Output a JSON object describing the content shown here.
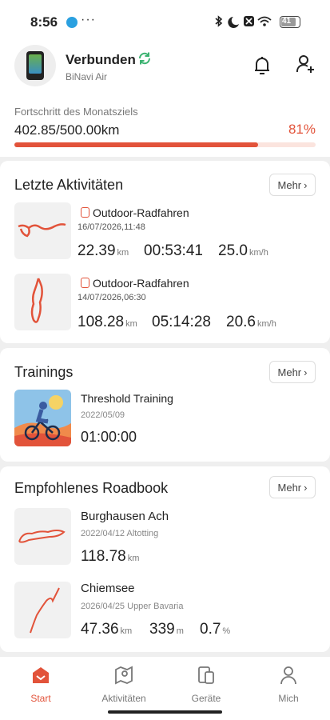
{
  "status_bar": {
    "time": "8:56",
    "more": "···",
    "battery": "41"
  },
  "header": {
    "connection_status": "Verbunden",
    "device_name": "BiNavi Air",
    "goal_label": "Fortschritt des Monatsziels",
    "goal_value": "402.85/500.00km",
    "goal_percent_text": "81%",
    "goal_progress": 0.81
  },
  "recent": {
    "title": "Letzte Aktivitäten",
    "more_label": "Mehr",
    "items": [
      {
        "type": "Outdoor-Radfahren",
        "datetime": "16/07/2026,11:48",
        "distance": "22.39",
        "distance_unit": "km",
        "duration": "00:53:41",
        "speed": "25.0",
        "speed_unit": "km/h"
      },
      {
        "type": "Outdoor-Radfahren",
        "datetime": "14/07/2026,06:30",
        "distance": "108.28",
        "distance_unit": "km",
        "duration": "05:14:28",
        "speed": "20.6",
        "speed_unit": "km/h"
      }
    ]
  },
  "trainings": {
    "title": "Trainings",
    "more_label": "Mehr",
    "item": {
      "name": "Threshold Training",
      "date": "2022/05/09",
      "duration": "01:00:00"
    }
  },
  "roadbook": {
    "title": "Empfohlenes Roadbook",
    "more_label": "Mehr",
    "items": [
      {
        "name": "Burghausen Ach",
        "date": "2022/04/12",
        "region": "Altotting",
        "distance": "118.78",
        "distance_unit": "km"
      },
      {
        "name": "Chiemsee",
        "date": "2026/04/25",
        "region": "Upper Bavaria",
        "distance": "47.36",
        "distance_unit": "km",
        "elevation": "339",
        "elevation_unit": "m",
        "grade": "0.7",
        "grade_unit": "%"
      }
    ]
  },
  "nav": {
    "items": [
      {
        "label": "Start",
        "icon": "home-icon",
        "active": true
      },
      {
        "label": "Aktivitäten",
        "icon": "map-pin-icon",
        "active": false
      },
      {
        "label": "Geräte",
        "icon": "devices-icon",
        "active": false
      },
      {
        "label": "Mich",
        "icon": "person-icon",
        "active": false
      }
    ]
  },
  "colors": {
    "accent": "#e2533a",
    "background": "#efefef",
    "success": "#3cb371"
  }
}
